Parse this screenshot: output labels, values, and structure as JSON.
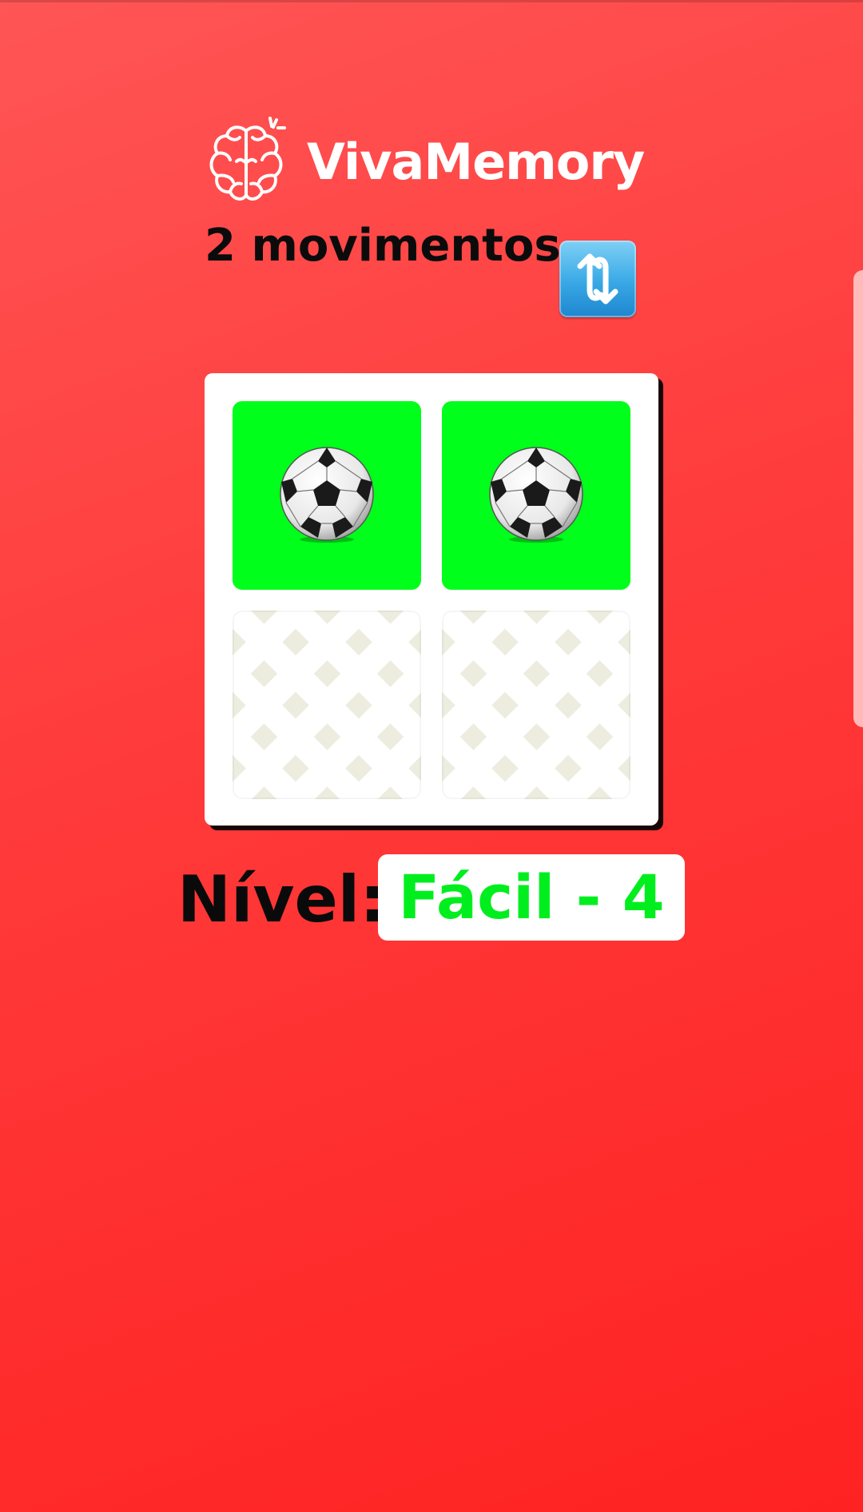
{
  "app": {
    "title": "VivaMemory",
    "logo_icon": "brain-icon"
  },
  "status": {
    "moves_text": "2 movimentos"
  },
  "controls": {
    "restart_icon": "restart-arrows-icon"
  },
  "board": {
    "rows": 2,
    "cols": 2,
    "cards": [
      {
        "state": "matched",
        "symbol": "⚽",
        "icon": "soccer-ball-icon",
        "color": "#00ff1a"
      },
      {
        "state": "matched",
        "symbol": "⚽",
        "icon": "soccer-ball-icon",
        "color": "#00ff1a"
      },
      {
        "state": "face-down",
        "symbol": "",
        "icon": "card-back-pattern"
      },
      {
        "state": "face-down",
        "symbol": "",
        "icon": "card-back-pattern"
      }
    ]
  },
  "level": {
    "label": "Nível:",
    "value": "Fácil - 4",
    "value_color": "#00ee1e"
  },
  "colors": {
    "background": "#ff3a3a",
    "accent": "#00ff1a"
  }
}
